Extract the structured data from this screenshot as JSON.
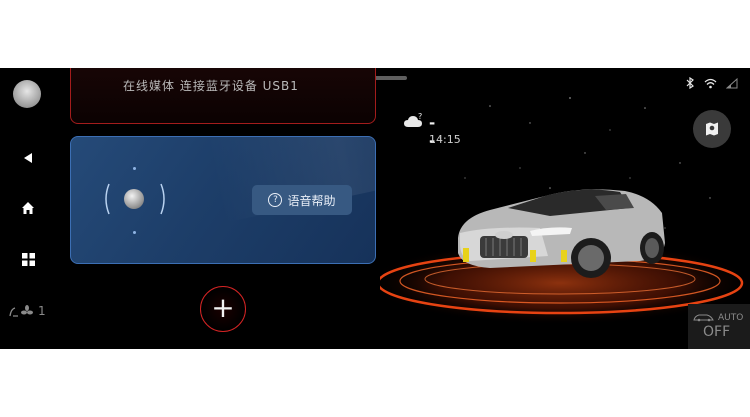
{
  "colors": {
    "background": "#000000",
    "accent_red": "#d42424",
    "voice_card_blue": "#1d3e69",
    "help_button": "#375982"
  },
  "sidebar": {
    "avatar_icon": "user-avatar",
    "back_icon": "back-triangle",
    "home_icon": "home",
    "apps_icon": "grid-apps",
    "fan_icon": "fan",
    "fan_level": "1"
  },
  "cards": {
    "top_card_text": "在线媒体    连接蓝牙设备    USB1"
  },
  "voice": {
    "help_label": "语音帮助"
  },
  "add_button_label": "+",
  "weather": {
    "icon": "cloud-question",
    "temperature": "--",
    "time": "14:15"
  },
  "status_bar": {
    "icons": [
      "bluetooth",
      "wifi",
      "cellular"
    ]
  },
  "map_button_icon": "map-pin",
  "climate": {
    "auto_label": "AUTO",
    "state_label": "OFF",
    "icon": "car-airflow"
  }
}
